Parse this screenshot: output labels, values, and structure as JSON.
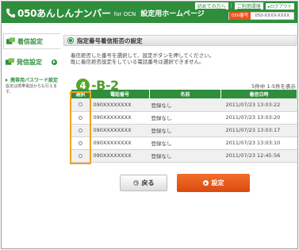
{
  "header": {
    "brand": "050あんしんナンバー",
    "for_ocn": "for OCN",
    "page_title": "設定用ホームページ",
    "link_first": "初めての方へ",
    "link_sep": "|",
    "link_howto": "ご利用環境",
    "logout": "▸ログアウト",
    "number_label": "050番号",
    "number_value": "050-XXXX-XXXX"
  },
  "sidebar": {
    "items": [
      {
        "label": "着信設定",
        "active": true
      },
      {
        "label": "発信設定",
        "active": false
      }
    ],
    "password": {
      "title": "携帯用パスワード設定",
      "text": "設定は携帯電話からも行えます。"
    }
  },
  "main": {
    "section_title": "指定番号着信拒否の設定",
    "desc_line1": "着信拒否した番号を選択して、設定ボタンを押してください。",
    "desc_line2": "既に着信拒否設定をしている電話番号は選択できません。",
    "callout_num": "4",
    "callout_code": "-B-2",
    "count": "5件中 1-5件を表示",
    "columns": [
      "選択",
      "電話番号",
      "名前",
      "着信日時"
    ],
    "rows": [
      {
        "number": "090XXXXXXXX",
        "name": "登録なし",
        "date": "2011/07/23 13:03:22"
      },
      {
        "number": "090XXXXXXXX",
        "name": "登録なし",
        "date": "2011/07/23 13:03:20"
      },
      {
        "number": "090XXXXXXXX",
        "name": "登録なし",
        "date": "2011/07/23 13:03:17"
      },
      {
        "number": "090XXXXXXXX",
        "name": "登録なし",
        "date": "2011/07/23 13:03:10"
      },
      {
        "number": "090XXXXXXXX",
        "name": "登録なし",
        "date": "2011/07/23 12:45:56"
      }
    ],
    "back_label": "戻る",
    "set_label": "設定"
  },
  "colors": {
    "brand_green": "#2f8e3c",
    "accent_orange": "#e8551b",
    "highlight_frame": "#f2a31f"
  },
  "icons": [
    "phone-icon",
    "incoming-call-icon",
    "outgoing-call-icon",
    "arrow-right-icon",
    "radio-icon",
    "back-icon",
    "set-icon"
  ]
}
